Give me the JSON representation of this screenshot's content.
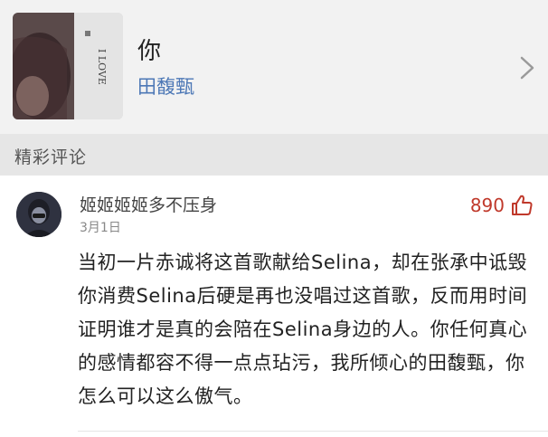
{
  "song": {
    "title": "你",
    "artist": "田馥甄",
    "cover_text": "I LOVE"
  },
  "section": {
    "title": "精彩评论"
  },
  "comment": {
    "username": "姬姬姬姬多不压身",
    "date": "3月1日",
    "likes": "890",
    "text": "当初一片赤诚将这首歌献给Selina，却在张承中诋毁你消费Selina后硬是再也没唱过这首歌，反而用时间证明谁才是真的会陪在Selina身边的人。你任何真心的感情都容不得一点点玷污，我所倾心的田馥甄，你怎么可以这么傲气。"
  },
  "colors": {
    "artist_link": "#4d78b6",
    "like_accent": "#c0392b",
    "section_bg": "#e6e6e6",
    "card_bg": "#f2f2f2"
  },
  "icons": {
    "chevron": "chevron-right-icon",
    "like": "thumbs-up-icon"
  }
}
